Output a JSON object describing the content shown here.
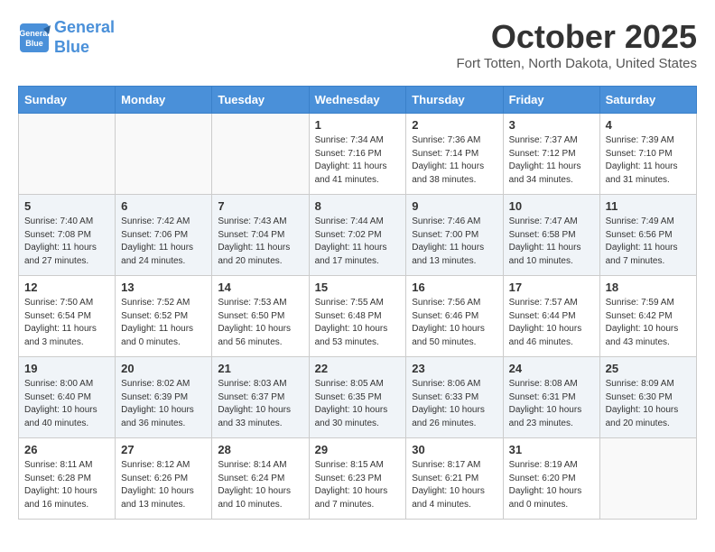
{
  "header": {
    "logo_line1": "General",
    "logo_line2": "Blue",
    "month": "October 2025",
    "location": "Fort Totten, North Dakota, United States"
  },
  "weekdays": [
    "Sunday",
    "Monday",
    "Tuesday",
    "Wednesday",
    "Thursday",
    "Friday",
    "Saturday"
  ],
  "weeks": [
    [
      {
        "day": "",
        "text": ""
      },
      {
        "day": "",
        "text": ""
      },
      {
        "day": "",
        "text": ""
      },
      {
        "day": "1",
        "text": "Sunrise: 7:34 AM\nSunset: 7:16 PM\nDaylight: 11 hours and 41 minutes."
      },
      {
        "day": "2",
        "text": "Sunrise: 7:36 AM\nSunset: 7:14 PM\nDaylight: 11 hours and 38 minutes."
      },
      {
        "day": "3",
        "text": "Sunrise: 7:37 AM\nSunset: 7:12 PM\nDaylight: 11 hours and 34 minutes."
      },
      {
        "day": "4",
        "text": "Sunrise: 7:39 AM\nSunset: 7:10 PM\nDaylight: 11 hours and 31 minutes."
      }
    ],
    [
      {
        "day": "5",
        "text": "Sunrise: 7:40 AM\nSunset: 7:08 PM\nDaylight: 11 hours and 27 minutes."
      },
      {
        "day": "6",
        "text": "Sunrise: 7:42 AM\nSunset: 7:06 PM\nDaylight: 11 hours and 24 minutes."
      },
      {
        "day": "7",
        "text": "Sunrise: 7:43 AM\nSunset: 7:04 PM\nDaylight: 11 hours and 20 minutes."
      },
      {
        "day": "8",
        "text": "Sunrise: 7:44 AM\nSunset: 7:02 PM\nDaylight: 11 hours and 17 minutes."
      },
      {
        "day": "9",
        "text": "Sunrise: 7:46 AM\nSunset: 7:00 PM\nDaylight: 11 hours and 13 minutes."
      },
      {
        "day": "10",
        "text": "Sunrise: 7:47 AM\nSunset: 6:58 PM\nDaylight: 11 hours and 10 minutes."
      },
      {
        "day": "11",
        "text": "Sunrise: 7:49 AM\nSunset: 6:56 PM\nDaylight: 11 hours and 7 minutes."
      }
    ],
    [
      {
        "day": "12",
        "text": "Sunrise: 7:50 AM\nSunset: 6:54 PM\nDaylight: 11 hours and 3 minutes."
      },
      {
        "day": "13",
        "text": "Sunrise: 7:52 AM\nSunset: 6:52 PM\nDaylight: 11 hours and 0 minutes."
      },
      {
        "day": "14",
        "text": "Sunrise: 7:53 AM\nSunset: 6:50 PM\nDaylight: 10 hours and 56 minutes."
      },
      {
        "day": "15",
        "text": "Sunrise: 7:55 AM\nSunset: 6:48 PM\nDaylight: 10 hours and 53 minutes."
      },
      {
        "day": "16",
        "text": "Sunrise: 7:56 AM\nSunset: 6:46 PM\nDaylight: 10 hours and 50 minutes."
      },
      {
        "day": "17",
        "text": "Sunrise: 7:57 AM\nSunset: 6:44 PM\nDaylight: 10 hours and 46 minutes."
      },
      {
        "day": "18",
        "text": "Sunrise: 7:59 AM\nSunset: 6:42 PM\nDaylight: 10 hours and 43 minutes."
      }
    ],
    [
      {
        "day": "19",
        "text": "Sunrise: 8:00 AM\nSunset: 6:40 PM\nDaylight: 10 hours and 40 minutes."
      },
      {
        "day": "20",
        "text": "Sunrise: 8:02 AM\nSunset: 6:39 PM\nDaylight: 10 hours and 36 minutes."
      },
      {
        "day": "21",
        "text": "Sunrise: 8:03 AM\nSunset: 6:37 PM\nDaylight: 10 hours and 33 minutes."
      },
      {
        "day": "22",
        "text": "Sunrise: 8:05 AM\nSunset: 6:35 PM\nDaylight: 10 hours and 30 minutes."
      },
      {
        "day": "23",
        "text": "Sunrise: 8:06 AM\nSunset: 6:33 PM\nDaylight: 10 hours and 26 minutes."
      },
      {
        "day": "24",
        "text": "Sunrise: 8:08 AM\nSunset: 6:31 PM\nDaylight: 10 hours and 23 minutes."
      },
      {
        "day": "25",
        "text": "Sunrise: 8:09 AM\nSunset: 6:30 PM\nDaylight: 10 hours and 20 minutes."
      }
    ],
    [
      {
        "day": "26",
        "text": "Sunrise: 8:11 AM\nSunset: 6:28 PM\nDaylight: 10 hours and 16 minutes."
      },
      {
        "day": "27",
        "text": "Sunrise: 8:12 AM\nSunset: 6:26 PM\nDaylight: 10 hours and 13 minutes."
      },
      {
        "day": "28",
        "text": "Sunrise: 8:14 AM\nSunset: 6:24 PM\nDaylight: 10 hours and 10 minutes."
      },
      {
        "day": "29",
        "text": "Sunrise: 8:15 AM\nSunset: 6:23 PM\nDaylight: 10 hours and 7 minutes."
      },
      {
        "day": "30",
        "text": "Sunrise: 8:17 AM\nSunset: 6:21 PM\nDaylight: 10 hours and 4 minutes."
      },
      {
        "day": "31",
        "text": "Sunrise: 8:19 AM\nSunset: 6:20 PM\nDaylight: 10 hours and 0 minutes."
      },
      {
        "day": "",
        "text": ""
      }
    ]
  ]
}
